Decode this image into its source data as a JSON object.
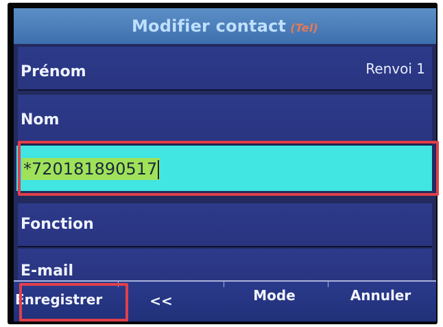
{
  "header": {
    "title": "Modifier contact",
    "tag": "(Tel)"
  },
  "fields": {
    "prenom_label": "Prénom",
    "prenom_right": "Renvoi 1",
    "nom_label": "Nom",
    "phone_value": "*720181890517",
    "fonction_label": "Fonction",
    "email_label": "E-mail"
  },
  "softkeys": {
    "save": "Enregistrer",
    "back": "<<",
    "mode": "Mode",
    "cancel": "Annuler"
  },
  "colors": {
    "screen_bg": "#232a5e",
    "title_bar": "#4a7cb9",
    "field_highlight": "#41e5e2",
    "text_selection": "#9fe25a",
    "callout": "#e0404a"
  }
}
